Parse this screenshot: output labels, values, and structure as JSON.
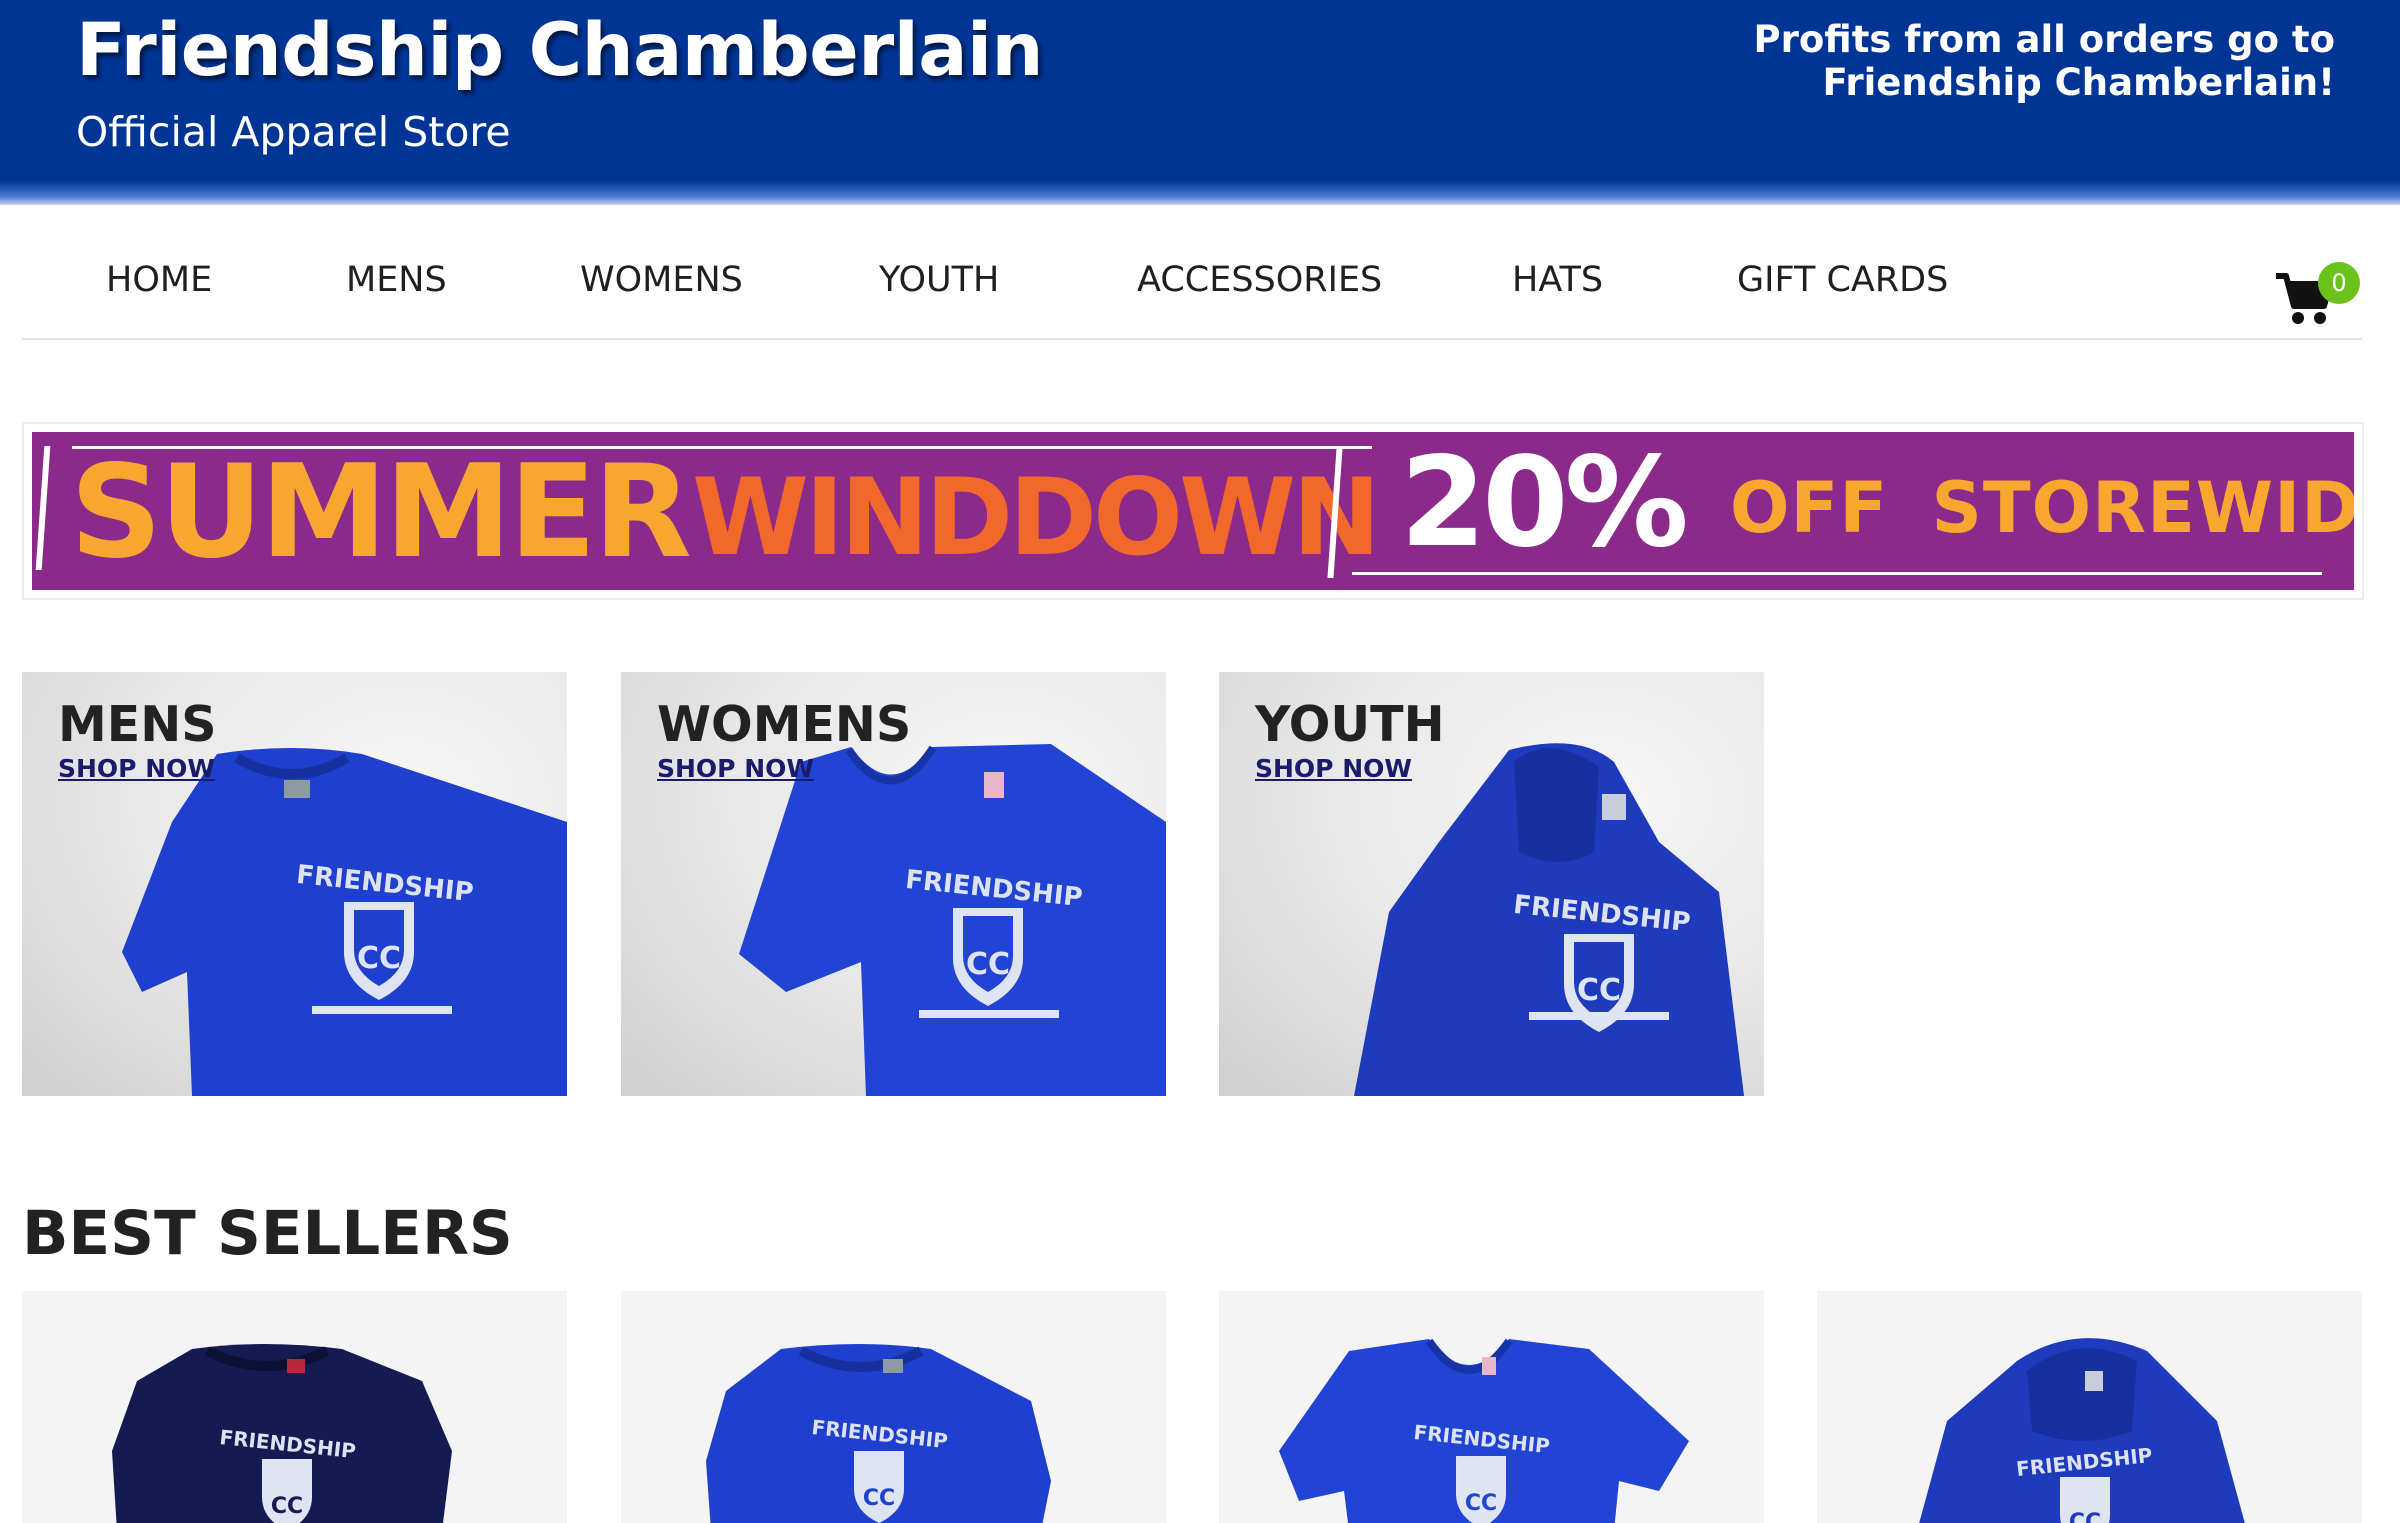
{
  "header": {
    "title": "Friendship Chamberlain",
    "subtitle": "Official Apparel Store",
    "profits_line1": "Profits from all orders go to",
    "profits_line2": "Friendship Chamberlain!"
  },
  "nav": {
    "items": [
      {
        "label": "HOME"
      },
      {
        "label": "MENS"
      },
      {
        "label": "WOMENS"
      },
      {
        "label": "YOUTH"
      },
      {
        "label": "ACCESSORIES"
      },
      {
        "label": "HATS"
      },
      {
        "label": "GIFT CARDS"
      }
    ],
    "cart_count": "0"
  },
  "banner": {
    "word1": "SUMMER",
    "word2": "WINDDOWN",
    "discount": "20%",
    "tail": "OFF STOREWIDE"
  },
  "categories": [
    {
      "title": "MENS",
      "link": "SHOP NOW"
    },
    {
      "title": "WOMENS",
      "link": "SHOP NOW"
    },
    {
      "title": "YOUTH",
      "link": "SHOP NOW"
    }
  ],
  "best_sellers": {
    "title": "BEST SELLERS"
  },
  "colors": {
    "header_blue": "#003596",
    "banner_purple": "#8c2a8c",
    "banner_orange": "#f7a630",
    "cart_badge": "#6bc21b",
    "shirt_royal": "#1f3fcf",
    "shirt_navy": "#141a52"
  }
}
